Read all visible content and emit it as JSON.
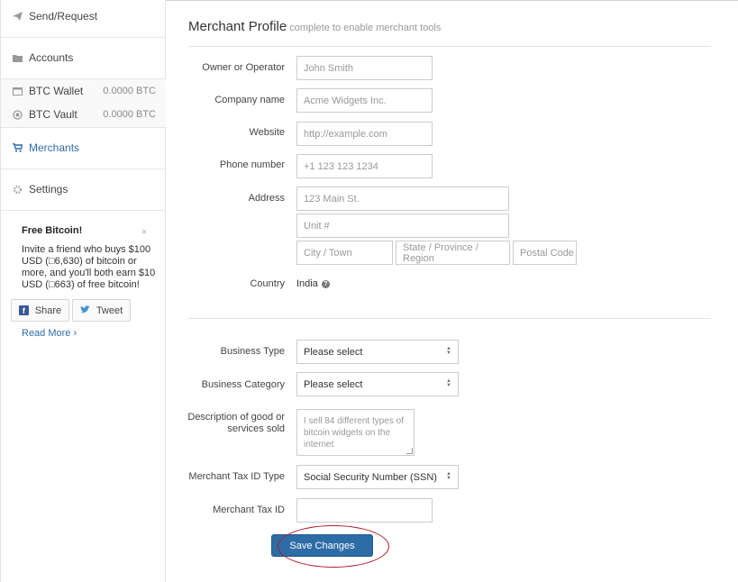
{
  "sidebar": {
    "send_request": "Send/Request",
    "accounts": "Accounts",
    "btc_wallet": {
      "label": "BTC Wallet",
      "balance": "0.0000 BTC"
    },
    "btc_vault": {
      "label": "BTC Vault",
      "balance": "0.0000 BTC"
    },
    "merchants": "Merchants",
    "settings": "Settings",
    "promo": {
      "title": "Free Bitcoin!",
      "close": "×",
      "text": "Invite a friend who buys $100 USD (□6,630) of bitcoin or more, and you'll both earn $10 USD (□663) of free bitcoin!",
      "share": "Share",
      "tweet": "Tweet",
      "read_more": "Read More ›"
    }
  },
  "header": {
    "title": "Merchant Profile",
    "subtitle": "complete to enable merchant tools"
  },
  "form": {
    "owner": {
      "label": "Owner or Operator",
      "placeholder": "John Smith"
    },
    "company": {
      "label": "Company name",
      "placeholder": "Acme Widgets Inc."
    },
    "website": {
      "label": "Website",
      "placeholder": "http://example.com"
    },
    "phone": {
      "label": "Phone number",
      "placeholder": "+1 123 123 1234"
    },
    "address": {
      "label": "Address",
      "line1": "123 Main St.",
      "line2": "Unit #",
      "city": "City / Town",
      "state": "State / Province / Region",
      "postal": "Postal Code"
    },
    "country": {
      "label": "Country",
      "value": "India",
      "help": "?"
    },
    "business_type": {
      "label": "Business Type",
      "value": "Please select"
    },
    "business_category": {
      "label": "Business Category",
      "value": "Please select"
    },
    "description": {
      "label_line1": "Description of good or",
      "label_line2": "services sold",
      "placeholder": "I sell 84 different types of bitcoin widgets on the internet"
    },
    "tax_id_type": {
      "label": "Merchant Tax ID Type",
      "value": "Social Security Number (SSN)"
    },
    "tax_id": {
      "label": "Merchant Tax ID",
      "value": ""
    },
    "save": "Save Changes"
  },
  "colors": {
    "accent": "#2d6ca7",
    "highlight": "#b01a2a"
  }
}
